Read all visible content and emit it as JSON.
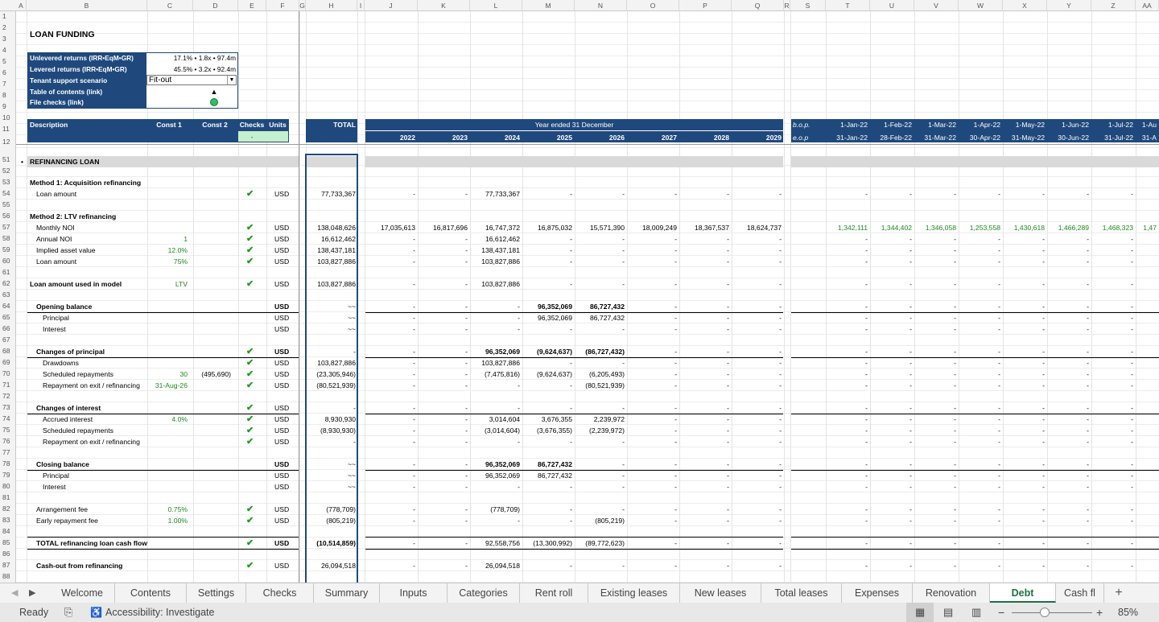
{
  "sheet_title": "LOAN FUNDING",
  "summary": {
    "unlev_label": "Unlevered returns (IRR•EqM•GR)",
    "unlev_value": "17.1% • 1.8x • 97.4m",
    "lev_label": "Levered returns (IRR•EqM•GR)",
    "lev_value": "45.5% • 3.2x • 92.4m",
    "scenario_label": "Tenant support scenario",
    "scenario_value": "Fit-out",
    "toc_label": "Table of contents (link)",
    "toc_glyph": "▲",
    "checks_label": "File checks (link)"
  },
  "columns": [
    "A",
    "B",
    "C",
    "D",
    "E",
    "F",
    "G",
    "H",
    "I",
    "J",
    "K",
    "L",
    "M",
    "N",
    "O",
    "P",
    "Q",
    "R",
    "S",
    "T",
    "U",
    "V",
    "W",
    "X",
    "Y",
    "Z",
    "AA"
  ],
  "rows": [
    "1",
    "2",
    "3",
    "4",
    "5",
    "6",
    "7",
    "8",
    "9",
    "10",
    "11",
    "12",
    "51",
    "52",
    "53",
    "54",
    "55",
    "56",
    "57",
    "58",
    "59",
    "60",
    "61",
    "62",
    "63",
    "64",
    "65",
    "66",
    "67",
    "68",
    "69",
    "70",
    "71",
    "72",
    "73",
    "74",
    "75",
    "76",
    "77",
    "78",
    "79",
    "80",
    "81",
    "82",
    "83",
    "84",
    "85",
    "86",
    "87",
    "88"
  ],
  "header": {
    "description": "Description",
    "const1": "Const 1",
    "const2": "Const 2",
    "checks": "Checks",
    "units": "Units",
    "total": "TOTAL",
    "checks_val": "-",
    "year_ended": "Year ended 31 December",
    "years": [
      "2022",
      "2023",
      "2024",
      "2025",
      "2026",
      "2027",
      "2028",
      "2029"
    ],
    "bop": "b.o.p.",
    "eop": "e.o.p",
    "bop_dates": [
      "1-Jan-22",
      "1-Feb-22",
      "1-Mar-22",
      "1-Apr-22",
      "1-May-22",
      "1-Jun-22",
      "1-Jul-22",
      "1-Au"
    ],
    "eop_dates": [
      "31-Jan-22",
      "28-Feb-22",
      "31-Mar-22",
      "30-Apr-22",
      "31-May-22",
      "30-Jun-22",
      "31-Jul-22",
      "31-A"
    ]
  },
  "section": {
    "bullet": "•",
    "title": "REFINANCING LOAN"
  },
  "data_rows": [
    {
      "row": "53",
      "label": "Method 1: Acquisition refinancing",
      "bold": true
    },
    {
      "row": "54",
      "label": "Loan amount",
      "indent": 1,
      "check": true,
      "units": "USD",
      "total": "77,733,367",
      "years": [
        "-",
        "-",
        "77,733,367",
        "-",
        "-",
        "-",
        "-",
        "-"
      ],
      "months": [
        "-",
        "-",
        "-",
        "-",
        "-",
        "-",
        "-"
      ]
    },
    {
      "row": "56",
      "label": "Method 2: LTV refinancing",
      "bold": true
    },
    {
      "row": "57",
      "label": "Monthly NOI",
      "indent": 1,
      "check": true,
      "units": "USD",
      "total": "138,048,626",
      "years": [
        "17,035,613",
        "16,817,696",
        "16,747,372",
        "16,875,032",
        "15,571,390",
        "18,009,249",
        "18,367,537",
        "18,624,737"
      ],
      "months": [
        "1,342,111",
        "1,344,402",
        "1,346,058",
        "1,253,558",
        "1,430,618",
        "1,466,289",
        "1,468,323",
        "1,47"
      ],
      "mgreen": true
    },
    {
      "row": "58",
      "label": "Annual NOI",
      "indent": 1,
      "c1": "1",
      "check": true,
      "units": "USD",
      "total": "16,612,462",
      "years": [
        "-",
        "-",
        "16,612,462",
        "-",
        "-",
        "-",
        "-",
        "-"
      ],
      "months": [
        "-",
        "-",
        "-",
        "-",
        "-",
        "-",
        "-"
      ]
    },
    {
      "row": "59",
      "label": "Implied asset value",
      "indent": 1,
      "c1": "12.0%",
      "check": true,
      "units": "USD",
      "total": "138,437,181",
      "years": [
        "-",
        "-",
        "138,437,181",
        "-",
        "-",
        "-",
        "-",
        "-"
      ],
      "months": [
        "-",
        "-",
        "-",
        "-",
        "-",
        "-",
        "-"
      ]
    },
    {
      "row": "60",
      "label": "Loan amount",
      "indent": 1,
      "c1": "75%",
      "check": true,
      "units": "USD",
      "total": "103,827,886",
      "years": [
        "-",
        "-",
        "103,827,886",
        "-",
        "-",
        "-",
        "-",
        "-"
      ],
      "months": [
        "-",
        "-",
        "-",
        "-",
        "-",
        "-",
        "-"
      ]
    },
    {
      "row": "62",
      "label": "Loan amount used in model",
      "bold": true,
      "c1": "LTV",
      "check": true,
      "units": "USD",
      "total": "103,827,886",
      "years": [
        "-",
        "-",
        "103,827,886",
        "-",
        "-",
        "-",
        "-",
        "-"
      ],
      "months": [
        "-",
        "-",
        "-",
        "-",
        "-",
        "-",
        "-"
      ]
    },
    {
      "row": "64",
      "label": "Opening balance",
      "bold": true,
      "indent": 1,
      "units": "USD",
      "ubold": true,
      "total": "~~",
      "years": [
        "-",
        "-",
        "-",
        "96,352,069",
        "86,727,432",
        "-",
        "-",
        "-"
      ],
      "ybold": true,
      "months": [
        "-",
        "-",
        "-",
        "-",
        "-",
        "-",
        "-"
      ],
      "line": true
    },
    {
      "row": "65",
      "label": "Principal",
      "indent": 2,
      "units": "USD",
      "total": "~~",
      "years": [
        "-",
        "-",
        "-",
        "96,352,069",
        "86,727,432",
        "-",
        "-",
        "-"
      ],
      "months": [
        "-",
        "-",
        "-",
        "-",
        "-",
        "-",
        "-"
      ]
    },
    {
      "row": "66",
      "label": "Interest",
      "indent": 2,
      "units": "USD",
      "total": "~~",
      "years": [
        "-",
        "-",
        "-",
        "-",
        "-",
        "-",
        "-",
        "-"
      ],
      "months": [
        "-",
        "-",
        "-",
        "-",
        "-",
        "-",
        "-"
      ]
    },
    {
      "row": "68",
      "label": "Changes of principal",
      "bold": true,
      "indent": 1,
      "check": true,
      "units": "USD",
      "ubold": true,
      "total": "-",
      "years": [
        "-",
        "-",
        "96,352,069",
        "(9,624,637)",
        "(86,727,432)",
        "-",
        "-",
        "-"
      ],
      "ybold": true,
      "months": [
        "-",
        "-",
        "-",
        "-",
        "-",
        "-",
        "-"
      ],
      "line": true
    },
    {
      "row": "69",
      "label": "Drawdowns",
      "indent": 2,
      "check": true,
      "units": "USD",
      "total": "103,827,886",
      "years": [
        "-",
        "-",
        "103,827,886",
        "-",
        "-",
        "-",
        "-",
        "-"
      ],
      "months": [
        "-",
        "-",
        "-",
        "-",
        "-",
        "-",
        "-"
      ]
    },
    {
      "row": "70",
      "label": "Scheduled repayments",
      "indent": 2,
      "c1": "30",
      "c2": "(495,690)",
      "check": true,
      "units": "USD",
      "total": "(23,305,946)",
      "years": [
        "-",
        "-",
        "(7,475,816)",
        "(9,624,637)",
        "(6,205,493)",
        "-",
        "-",
        "-"
      ],
      "months": [
        "-",
        "-",
        "-",
        "-",
        "-",
        "-",
        "-"
      ]
    },
    {
      "row": "71",
      "label": "Repayment on exit / refinancing",
      "indent": 2,
      "c1": "31-Aug-26",
      "check": true,
      "units": "USD",
      "total": "(80,521,939)",
      "years": [
        "-",
        "-",
        "-",
        "-",
        "(80,521,939)",
        "-",
        "-",
        "-"
      ],
      "months": [
        "-",
        "-",
        "-",
        "-",
        "-",
        "-",
        "-"
      ]
    },
    {
      "row": "73",
      "label": "Changes of interest",
      "bold": true,
      "indent": 1,
      "check": true,
      "units": "USD",
      "total": "-",
      "years": [
        "-",
        "-",
        "-",
        "-",
        "-",
        "-",
        "-",
        "-"
      ],
      "months": [
        "-",
        "-",
        "-",
        "-",
        "-",
        "-",
        "-"
      ],
      "line": true
    },
    {
      "row": "74",
      "label": "Accrued interest",
      "indent": 2,
      "c1": "4.0%",
      "check": true,
      "units": "USD",
      "total": "8,930,930",
      "years": [
        "-",
        "-",
        "3,014,604",
        "3,676,355",
        "2,239,972",
        "-",
        "-",
        "-"
      ],
      "months": [
        "-",
        "-",
        "-",
        "-",
        "-",
        "-",
        "-"
      ]
    },
    {
      "row": "75",
      "label": "Scheduled repayments",
      "indent": 2,
      "check": true,
      "units": "USD",
      "total": "(8,930,930)",
      "years": [
        "-",
        "-",
        "(3,014,604)",
        "(3,676,355)",
        "(2,239,972)",
        "-",
        "-",
        "-"
      ],
      "months": [
        "-",
        "-",
        "-",
        "-",
        "-",
        "-",
        "-"
      ]
    },
    {
      "row": "76",
      "label": "Repayment on exit / refinancing",
      "indent": 2,
      "check": true,
      "units": "USD",
      "total": "-",
      "years": [
        "-",
        "-",
        "-",
        "-",
        "-",
        "-",
        "-",
        "-"
      ],
      "months": [
        "-",
        "-",
        "-",
        "-",
        "-",
        "-",
        "-"
      ]
    },
    {
      "row": "78",
      "label": "Closing balance",
      "bold": true,
      "indent": 1,
      "units": "USD",
      "ubold": true,
      "total": "~~",
      "years": [
        "-",
        "-",
        "96,352,069",
        "86,727,432",
        "-",
        "-",
        "-",
        "-"
      ],
      "ybold": true,
      "months": [
        "-",
        "-",
        "-",
        "-",
        "-",
        "-",
        "-"
      ],
      "line": true
    },
    {
      "row": "79",
      "label": "Principal",
      "indent": 2,
      "units": "USD",
      "total": "~~",
      "years": [
        "-",
        "-",
        "96,352,069",
        "86,727,432",
        "-",
        "-",
        "-",
        "-"
      ],
      "months": [
        "-",
        "-",
        "-",
        "-",
        "-",
        "-",
        "-"
      ]
    },
    {
      "row": "80",
      "label": "Interest",
      "indent": 2,
      "units": "USD",
      "total": "~~",
      "years": [
        "-",
        "-",
        "-",
        "-",
        "-",
        "-",
        "-",
        "-"
      ],
      "months": [
        "-",
        "-",
        "-",
        "-",
        "-",
        "-",
        "-"
      ]
    },
    {
      "row": "82",
      "label": "Arrangement fee",
      "indent": 1,
      "c1": "0.75%",
      "check": true,
      "units": "USD",
      "total": "(778,709)",
      "years": [
        "-",
        "-",
        "(778,709)",
        "-",
        "-",
        "-",
        "-",
        "-"
      ],
      "months": [
        "-",
        "-",
        "-",
        "-",
        "-",
        "-",
        "-"
      ]
    },
    {
      "row": "83",
      "label": "Early repayment fee",
      "indent": 1,
      "c1": "1.00%",
      "check": true,
      "units": "USD",
      "total": "(805,219)",
      "years": [
        "-",
        "-",
        "-",
        "-",
        "(805,219)",
        "-",
        "-",
        "-"
      ],
      "months": [
        "-",
        "-",
        "-",
        "-",
        "-",
        "-",
        "-"
      ]
    },
    {
      "row": "85",
      "label": "TOTAL refinancing loan cash flow",
      "bold": true,
      "indent": 1,
      "check": true,
      "units": "USD",
      "ubold": true,
      "total": "(10,514,859)",
      "tbold": true,
      "years": [
        "-",
        "-",
        "92,558,756",
        "(13,300,992)",
        "(89,772,623)",
        "-",
        "-",
        "-"
      ],
      "months": [
        "-",
        "-",
        "-",
        "-",
        "-",
        "-",
        "-"
      ],
      "line": true,
      "linebelow": true
    },
    {
      "row": "87",
      "label": "Cash-out from refinancing",
      "bold": true,
      "indent": 1,
      "check": true,
      "units": "USD",
      "total": "26,094,518",
      "years": [
        "-",
        "-",
        "26,094,518",
        "-",
        "-",
        "-",
        "-",
        "-"
      ],
      "months": [
        "-",
        "-",
        "-",
        "-",
        "-",
        "-",
        "-"
      ]
    }
  ],
  "tabs": [
    "Welcome",
    "Contents",
    "Settings",
    "Checks",
    "Summary",
    "Inputs",
    "Categories",
    "Rent roll",
    "Existing leases",
    "New leases",
    "Total leases",
    "Expenses",
    "Renovation",
    "Debt",
    "Cash fl"
  ],
  "active_tab": "Debt",
  "add_sheet": "+",
  "status": {
    "ready": "Ready",
    "accessibility": "Accessibility: Investigate",
    "zoom": "85%",
    "minus": "−",
    "plus": "+"
  },
  "colors": {
    "header_blue": "#1f497d",
    "green": "#1a8a1a",
    "active_tab": "#1e7145"
  }
}
